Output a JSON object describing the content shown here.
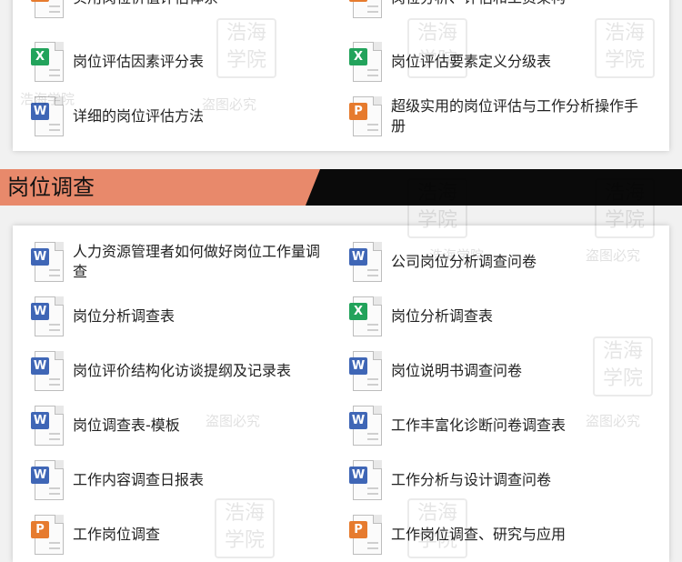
{
  "top_section": {
    "items": [
      {
        "type": "ppt",
        "badge": "P",
        "label": "实用岗位价值评估体系"
      },
      {
        "type": "ppt",
        "badge": "P",
        "label": "岗位分析、评估和工资架构"
      },
      {
        "type": "excel",
        "badge": "X",
        "label": "岗位评估因素评分表"
      },
      {
        "type": "excel",
        "badge": "X",
        "label": "岗位评估要素定义分级表"
      },
      {
        "type": "word",
        "badge": "W",
        "label": "详细的岗位评估方法"
      },
      {
        "type": "ppt",
        "badge": "P",
        "label": "超级实用的岗位评估与工作分析操作手册"
      }
    ]
  },
  "section": {
    "title": "岗位调查",
    "items": [
      {
        "type": "word",
        "badge": "W",
        "label": "人力资源管理者如何做好岗位工作量调查"
      },
      {
        "type": "word",
        "badge": "W",
        "label": "公司岗位分析调查问卷"
      },
      {
        "type": "word",
        "badge": "W",
        "label": "岗位分析调查表"
      },
      {
        "type": "excel",
        "badge": "X",
        "label": "岗位分析调查表"
      },
      {
        "type": "word",
        "badge": "W",
        "label": "岗位评价结构化访谈提纲及记录表"
      },
      {
        "type": "word",
        "badge": "W",
        "label": "岗位说明书调查问卷"
      },
      {
        "type": "word",
        "badge": "W",
        "label": "岗位调查表-模板"
      },
      {
        "type": "word",
        "badge": "W",
        "label": "工作丰富化诊断问卷调查表"
      },
      {
        "type": "word",
        "badge": "W",
        "label": "工作内容调查日报表"
      },
      {
        "type": "word",
        "badge": "W",
        "label": "工作分析与设计调查问卷"
      },
      {
        "type": "ppt",
        "badge": "P",
        "label": "工作岗位调查"
      },
      {
        "type": "ppt",
        "badge": "P",
        "label": "工作岗位调查、研究与应用"
      }
    ]
  },
  "watermark": {
    "text": "盗图必究",
    "brand": "浩海学院",
    "seal": "浩海学院"
  },
  "colors": {
    "word": "#3f66b6",
    "excel": "#22a35b",
    "ppt": "#e67b2e",
    "header_orange": "#e8896b",
    "header_black": "#0a0a0a"
  }
}
